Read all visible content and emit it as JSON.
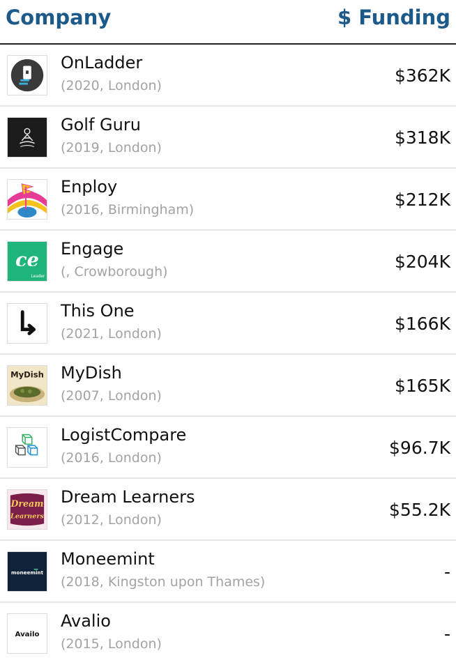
{
  "header": {
    "company_label": "Company",
    "funding_label": "$ Funding"
  },
  "rows": [
    {
      "name": "OnLadder",
      "meta": "(2020, London)",
      "funding": "$362K",
      "logo": "onladder-logo"
    },
    {
      "name": "Golf Guru",
      "meta": "(2019, London)",
      "funding": "$318K",
      "logo": "golf-guru-logo"
    },
    {
      "name": "Enploy",
      "meta": "(2016, Birmingham)",
      "funding": "$212K",
      "logo": "enploy-logo"
    },
    {
      "name": "Engage",
      "meta": "(, Crowborough)",
      "funding": "$204K",
      "logo": "engage-logo",
      "logo_text": "Leader"
    },
    {
      "name": "This One",
      "meta": "(2021, London)",
      "funding": "$166K",
      "logo": "this-one-logo"
    },
    {
      "name": "MyDish",
      "meta": "(2007, London)",
      "funding": "$165K",
      "logo": "mydish-logo",
      "logo_text": "MyDish"
    },
    {
      "name": "LogistCompare",
      "meta": "(2016, London)",
      "funding": "$96.7K",
      "logo": "logistcompare-logo"
    },
    {
      "name": "Dream Learners",
      "meta": "(2012, London)",
      "funding": "$55.2K",
      "logo": "dream-learners-logo",
      "logo_text": "Dream Learners"
    },
    {
      "name": "Moneemint",
      "meta": "(2018, Kingston upon Thames)",
      "funding": "-",
      "logo": "moneemint-logo",
      "logo_text": "moneemint"
    },
    {
      "name": "Avalio",
      "meta": "(2015, London)",
      "funding": "-",
      "logo": "avalio-logo",
      "logo_text": "Availo"
    }
  ],
  "colors": {
    "header_text": "#1d5a8a",
    "meta_text": "#a3a3a3"
  }
}
